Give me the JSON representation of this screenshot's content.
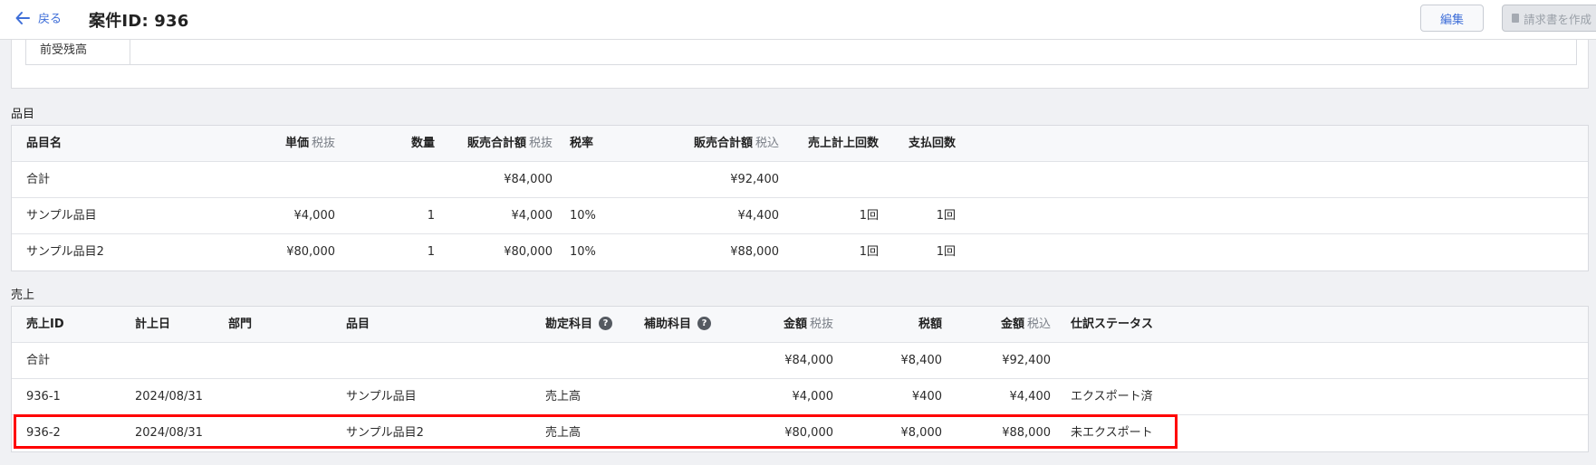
{
  "header": {
    "back_label": "戻る",
    "title": "案件ID: 936",
    "edit_label": "編集",
    "invoice_label": "請求書を作成"
  },
  "top_card": {
    "prior_balance_label": "前受残高"
  },
  "items": {
    "section_title": "品目",
    "columns": {
      "name": "品目名",
      "unit_price": "単価",
      "unit_price_sub": "税抜",
      "qty": "数量",
      "total_ex": "販売合計額",
      "total_ex_sub": "税抜",
      "tax_rate": "税率",
      "total_in": "販売合計額",
      "total_in_sub": "税込",
      "sales_count": "売上計上回数",
      "pay_count": "支払回数"
    },
    "total": {
      "label": "合計",
      "total_ex": "¥84,000",
      "total_in": "¥92,400"
    },
    "rows": [
      {
        "name": "サンプル品目",
        "unit_price": "¥4,000",
        "qty": "1",
        "total_ex": "¥4,000",
        "tax_rate": "10%",
        "total_in": "¥4,400",
        "sales_count": "1回",
        "pay_count": "1回"
      },
      {
        "name": "サンプル品目2",
        "unit_price": "¥80,000",
        "qty": "1",
        "total_ex": "¥80,000",
        "tax_rate": "10%",
        "total_in": "¥88,000",
        "sales_count": "1回",
        "pay_count": "1回"
      }
    ]
  },
  "sales": {
    "section_title": "売上",
    "columns": {
      "id": "売上ID",
      "date": "計上日",
      "dept": "部門",
      "item": "品目",
      "account": "勘定科目",
      "sub_account": "補助科目",
      "amount_ex": "金額",
      "amount_ex_sub": "税抜",
      "tax": "税額",
      "amount_in": "金額",
      "amount_in_sub": "税込",
      "status": "仕訳ステータス"
    },
    "help_glyph": "?",
    "total": {
      "label": "合計",
      "amount_ex": "¥84,000",
      "tax": "¥8,400",
      "amount_in": "¥92,400"
    },
    "rows": [
      {
        "id": "936-1",
        "date": "2024/08/31",
        "dept": "",
        "item": "サンプル品目",
        "account": "売上高",
        "sub_account": "",
        "amount_ex": "¥4,000",
        "tax": "¥400",
        "amount_in": "¥4,400",
        "status": "エクスポート済"
      },
      {
        "id": "936-2",
        "date": "2024/08/31",
        "dept": "",
        "item": "サンプル品目2",
        "account": "売上高",
        "sub_account": "",
        "amount_ex": "¥80,000",
        "tax": "¥8,000",
        "amount_in": "¥88,000",
        "status": "未エクスポート"
      }
    ]
  },
  "colors": {
    "accent": "#3e6ed8",
    "highlight": "#ff0000"
  }
}
